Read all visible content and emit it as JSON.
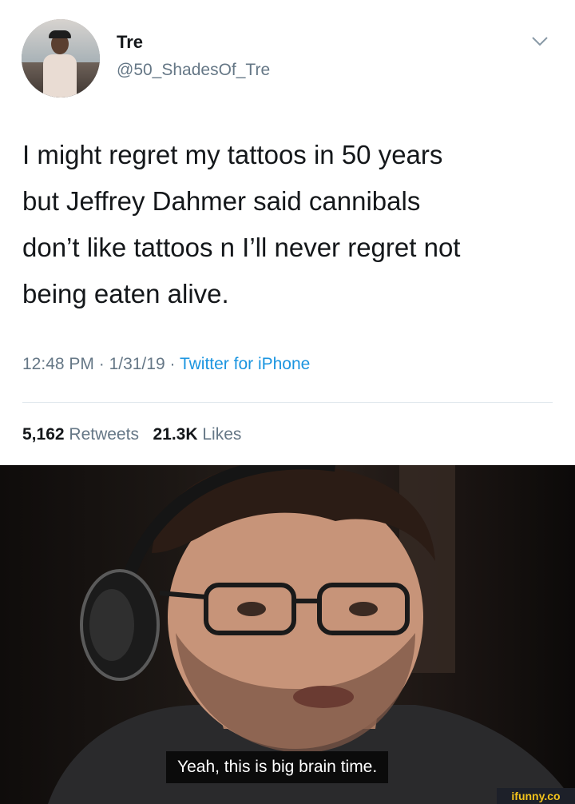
{
  "tweet": {
    "display_name": "Tre",
    "handle": "@50_ShadesOf_Tre",
    "text": "I might regret my tattoos in 50 years\nbut Jeffrey Dahmer said cannibals\ndon’t like tattoos n I’ll never regret not\nbeing eaten alive.",
    "time": "12:48 PM",
    "date": "1/31/19",
    "separator": " · ",
    "source": "Twitter for iPhone",
    "retweets_count": "5,162",
    "retweets_label": "Retweets",
    "likes_count": "21.3K",
    "likes_label": "Likes"
  },
  "meme": {
    "caption": "Yeah, this is big brain time.",
    "watermark": "ifunny.co"
  },
  "colors": {
    "primary_text": "#14171a",
    "secondary_text": "#657786",
    "link": "#1b95e0",
    "divider": "#e1e8ed",
    "watermark_text": "#f3c31b"
  },
  "icons": {
    "menu": "chevron-down-icon"
  }
}
